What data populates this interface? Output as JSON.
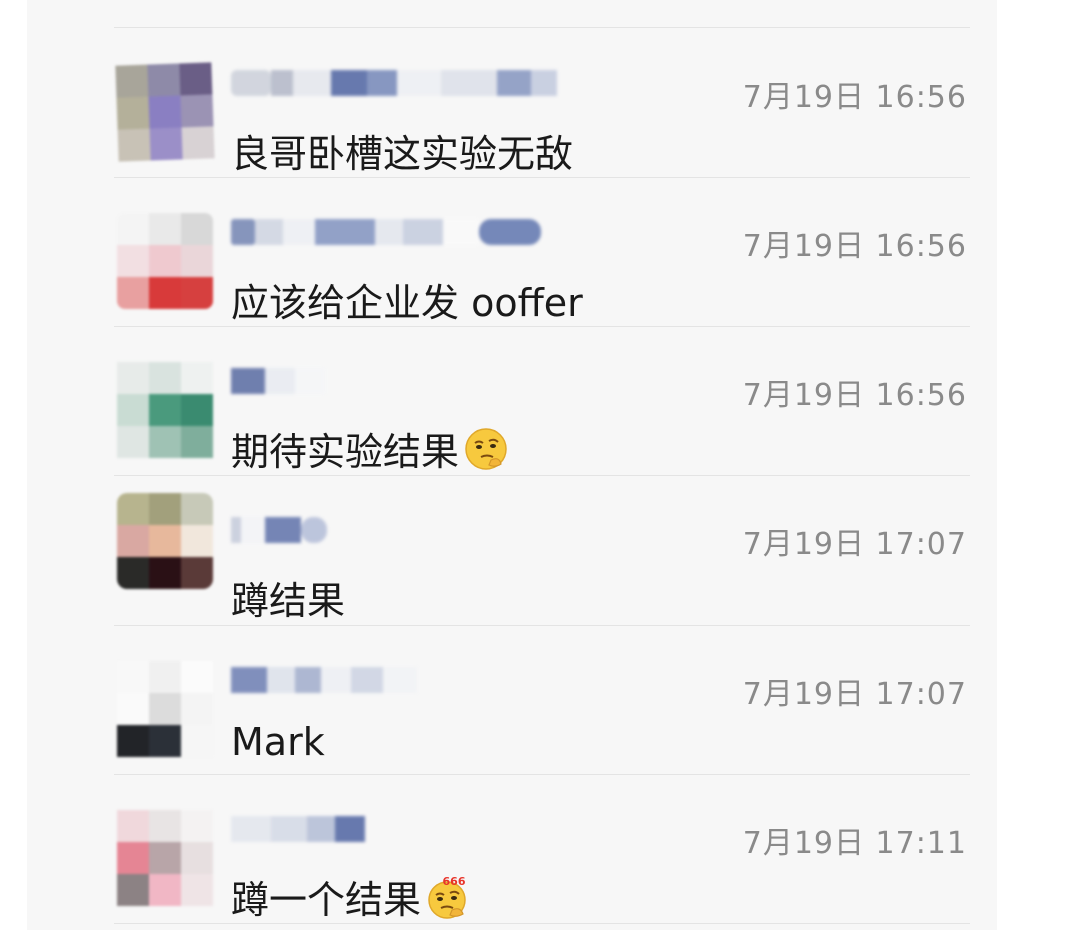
{
  "comments": [
    {
      "time": "7月19日 16:56",
      "text": "良哥卧槽这实验无敌",
      "emoji": ""
    },
    {
      "time": "7月19日 16:56",
      "text": "应该给企业发 ooffer",
      "emoji": ""
    },
    {
      "time": "7月19日 16:56",
      "text": "期待实验结果",
      "emoji": "thinking-face-icon"
    },
    {
      "time": "7月19日 17:07",
      "text": "蹲结果",
      "emoji": ""
    },
    {
      "time": "7月19日 17:07",
      "text": "Mark",
      "emoji": ""
    },
    {
      "time": "7月19日 17:11",
      "text": "蹲一个结果",
      "emoji": "666-thinking-face-icon"
    }
  ],
  "emoji_badge_text": "666",
  "colors": {
    "panel_background": "#f7f7f7",
    "time_text": "#8a8a8a",
    "message_text": "#1a1a1a",
    "name_redacted": "#5b6fa8"
  }
}
